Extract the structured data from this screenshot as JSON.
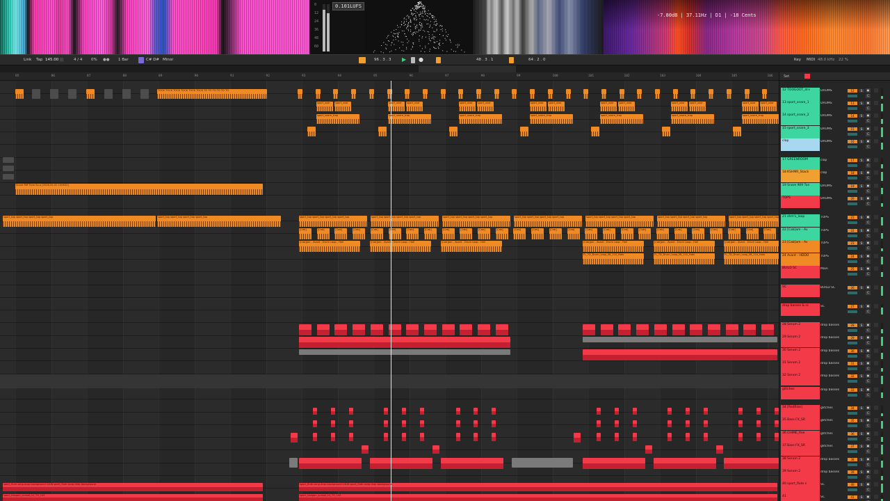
{
  "visualizer": {
    "lufs": "0.101LUFS",
    "meter_ticks": [
      "0",
      "12",
      "24",
      "36",
      "48",
      "60"
    ],
    "pitch": {
      "level": "-7.80dB",
      "freq": "37.11Hz",
      "note": "D1",
      "cents": "-18 Cents"
    }
  },
  "transport": {
    "link": "Link",
    "tap": "Tap",
    "tempo": "145.00",
    "signature": "4 / 4",
    "metro_pct": "0%",
    "quantize": "1 Bar",
    "key": "C# D#",
    "scale": "Minor",
    "position": "96 . 3 . 3",
    "loop_start": "48 . 3 . 1",
    "loop_length": "64 . 2 . 0",
    "key_label": "Key",
    "midi_label": "MIDI",
    "sample_rate": "48.0 kHz",
    "cpu": "22 %"
  },
  "ruler": {
    "bars": [
      "85",
      "86",
      "87",
      "88",
      "89",
      "90",
      "91",
      "92",
      "93",
      "94",
      "95",
      "96",
      "97",
      "98",
      "99",
      "100",
      "101",
      "102",
      "103",
      "104",
      "105",
      "106"
    ]
  },
  "clips": {
    "snare_fill": "Snare Riff Tune So p [2026-02-02 100632]",
    "kick_row": "TOCK TOCK TOCK TOCK TOCK TOCK TO TO TO TO TO TO",
    "snare_a": "sport_snar",
    "snare_b": "sport_snare_trap",
    "hat_row": "sport_top sport_top sport_top sport_top",
    "cabstam": "[Cab]",
    "drumloop": "[Cab]am - Avant - Drum Loop - Hell",
    "fl_loop": "FL_TD_Drum_Loop_08_110_Hats",
    "vox_bottom_a": "sport_flute song drop background 140B sport_flute song drop background",
    "vox_bottom_b": "sport_tlangan_sunset_tri_TH_143"
  },
  "panel": {
    "header": "Set",
    "tracks": [
      {
        "name": "12 TOOGOOT_drv",
        "route": "DRUMS",
        "vol": "12",
        "num": "S",
        "color": "#3ed6a0"
      },
      {
        "name": "13 sport_snare_1",
        "route": "DRUMS",
        "vol": "13",
        "num": "S",
        "color": "#3ed6a0"
      },
      {
        "name": "14 sport_snare_2",
        "route": "DRUMS",
        "vol": "14",
        "num": "S",
        "color": "#3ed6a0"
      },
      {
        "name": "15 sport_snare_3",
        "route": "DRUMS",
        "vol": "15",
        "num": "S",
        "color": "#3ed6a0"
      },
      {
        "name": "clap",
        "route": "DRUMS",
        "vol": "16",
        "num": "S",
        "color": "#a8d8f0"
      },
      {
        "name": "17 GREENROOM",
        "route": "clap",
        "vol": "17",
        "num": "S",
        "color": "#3ed6a0"
      },
      {
        "name": "18 KSHMR_Stack",
        "route": "clap",
        "vol": "18",
        "num": "S",
        "color": "#f0a030"
      },
      {
        "name": "19 Snare 909 Tun",
        "route": "DRUMS",
        "vol": "19",
        "num": "S",
        "color": "#3ed6a0"
      },
      {
        "name": "TOPS",
        "route": "DRUMS",
        "vol": "20",
        "num": "S",
        "color": "#f23a48"
      },
      {
        "name": "21 shm's_loop",
        "route": "TOPS",
        "vol": "21",
        "num": "S",
        "color": "#3ed6a0"
      },
      {
        "name": "22 [Cab]am - Av",
        "route": "TOPS",
        "vol": "22",
        "num": "S",
        "color": "#3ed6a0"
      },
      {
        "name": "23 [Cab]am - Av",
        "route": "TOPS",
        "vol": "23",
        "num": "S",
        "color": "#f08a24"
      },
      {
        "name": "24 Avant - HDDO",
        "route": "TOPS",
        "vol": "24",
        "num": "S",
        "color": "#f08a24"
      },
      {
        "name": "BUILD SC",
        "route": "Main",
        "vol": "25",
        "num": "S",
        "color": "#f23a48"
      },
      {
        "name": "SC",
        "route": "BUILD SC",
        "vol": "26",
        "num": "S",
        "color": "#f23a48"
      },
      {
        "name": "drop basses & sc",
        "route": "SC",
        "vol": "27",
        "num": "S",
        "color": "#f23a48"
      },
      {
        "name": "28 Serum 2",
        "route": "drop basses",
        "vol": "28",
        "num": "S",
        "color": "#f23a48"
      },
      {
        "name": "29 Serum 2",
        "route": "drop basses",
        "vol": "29",
        "num": "S",
        "color": "#f23a48"
      },
      {
        "name": "30 Serum 2",
        "route": "drop basses",
        "vol": "30",
        "num": "S",
        "color": "#f23a48"
      },
      {
        "name": "31 Serum 2",
        "route": "drop basses",
        "vol": "31",
        "num": "S",
        "color": "#f23a48"
      },
      {
        "name": "32 Serum 2",
        "route": "drop basses",
        "vol": "32",
        "num": "S",
        "color": "#f23a48"
      },
      {
        "name": "glitches",
        "route": "drop basses",
        "vol": "33",
        "num": "S",
        "color": "#f23a48"
      },
      {
        "name": "34 [RedRise]",
        "route": "glitches",
        "vol": "34",
        "num": "S",
        "color": "#f23a48"
      },
      {
        "name": "35 Bass FX_SR",
        "route": "glitches",
        "vol": "35",
        "num": "S",
        "color": "#f23a48"
      },
      {
        "name": "36 CHIME_fine",
        "route": "glitches",
        "vol": "36",
        "num": "S",
        "color": "#f23a48"
      },
      {
        "name": "37 Bass FX_SR",
        "route": "glitches",
        "vol": "37",
        "num": "S",
        "color": "#f23a48"
      },
      {
        "name": "38 Serum 2",
        "route": "drop basses",
        "vol": "38",
        "num": "S",
        "color": "#f23a48"
      },
      {
        "name": "39 Serum 2",
        "route": "drop basses",
        "vol": "39",
        "num": "S",
        "color": "#f23a48"
      },
      {
        "name": "40 sport_flute s",
        "route": "SC",
        "vol": "40",
        "num": "S",
        "color": "#f23a48"
      },
      {
        "name": "41",
        "route": "SC",
        "vol": "41",
        "num": "S",
        "color": "#f23a48"
      }
    ]
  },
  "colors": {
    "orange": "#f08a24",
    "red": "#f23a48",
    "teal": "#3ed6a0",
    "playhead": "#e8e8e8"
  }
}
